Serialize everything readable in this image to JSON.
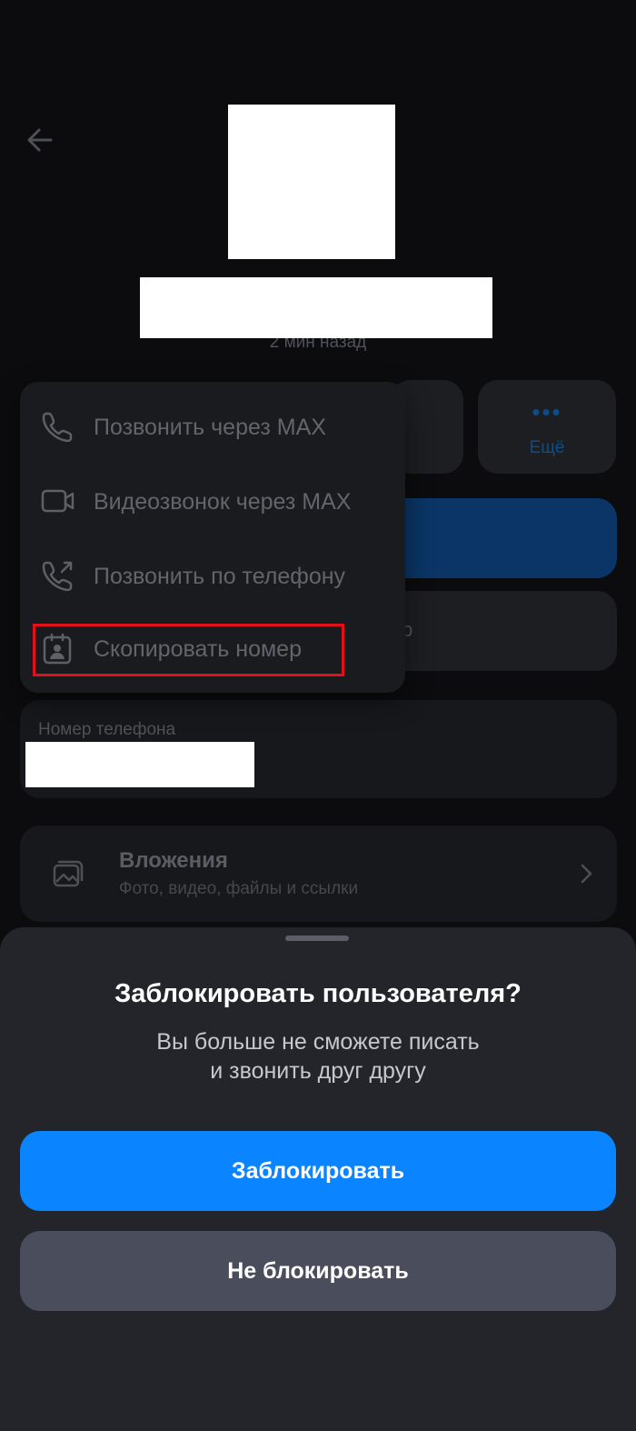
{
  "profile": {
    "last_seen": "2 мин назад",
    "more_action_label": "Ещё",
    "more_action_icon": "more-dots-icon",
    "phone_label": "Номер телефона"
  },
  "attachments": {
    "title": "Вложения",
    "subtitle": "Фото, видео, файлы и ссылки"
  },
  "context_menu": {
    "items": [
      {
        "label": "Позвонить через MAX",
        "icon": "phone-icon"
      },
      {
        "label": "Видеозвонок через MAX",
        "icon": "video-camera-icon"
      },
      {
        "label": "Позвонить по телефону",
        "icon": "phone-outgoing-icon"
      },
      {
        "label": "Скопировать номер",
        "icon": "contact-card-icon"
      }
    ],
    "highlight_color": "#e3101a"
  },
  "block_sheet": {
    "title": "Заблокировать пользователя?",
    "message_line1": "Вы больше не сможете писать",
    "message_line2": "и звонить друг другу",
    "confirm_label": "Заблокировать",
    "cancel_label": "Не блокировать"
  },
  "colors": {
    "background": "#0c0c0e",
    "accent": "#0a84ff",
    "sheet": "#23252b",
    "secondary_button": "#4a4d5c"
  }
}
